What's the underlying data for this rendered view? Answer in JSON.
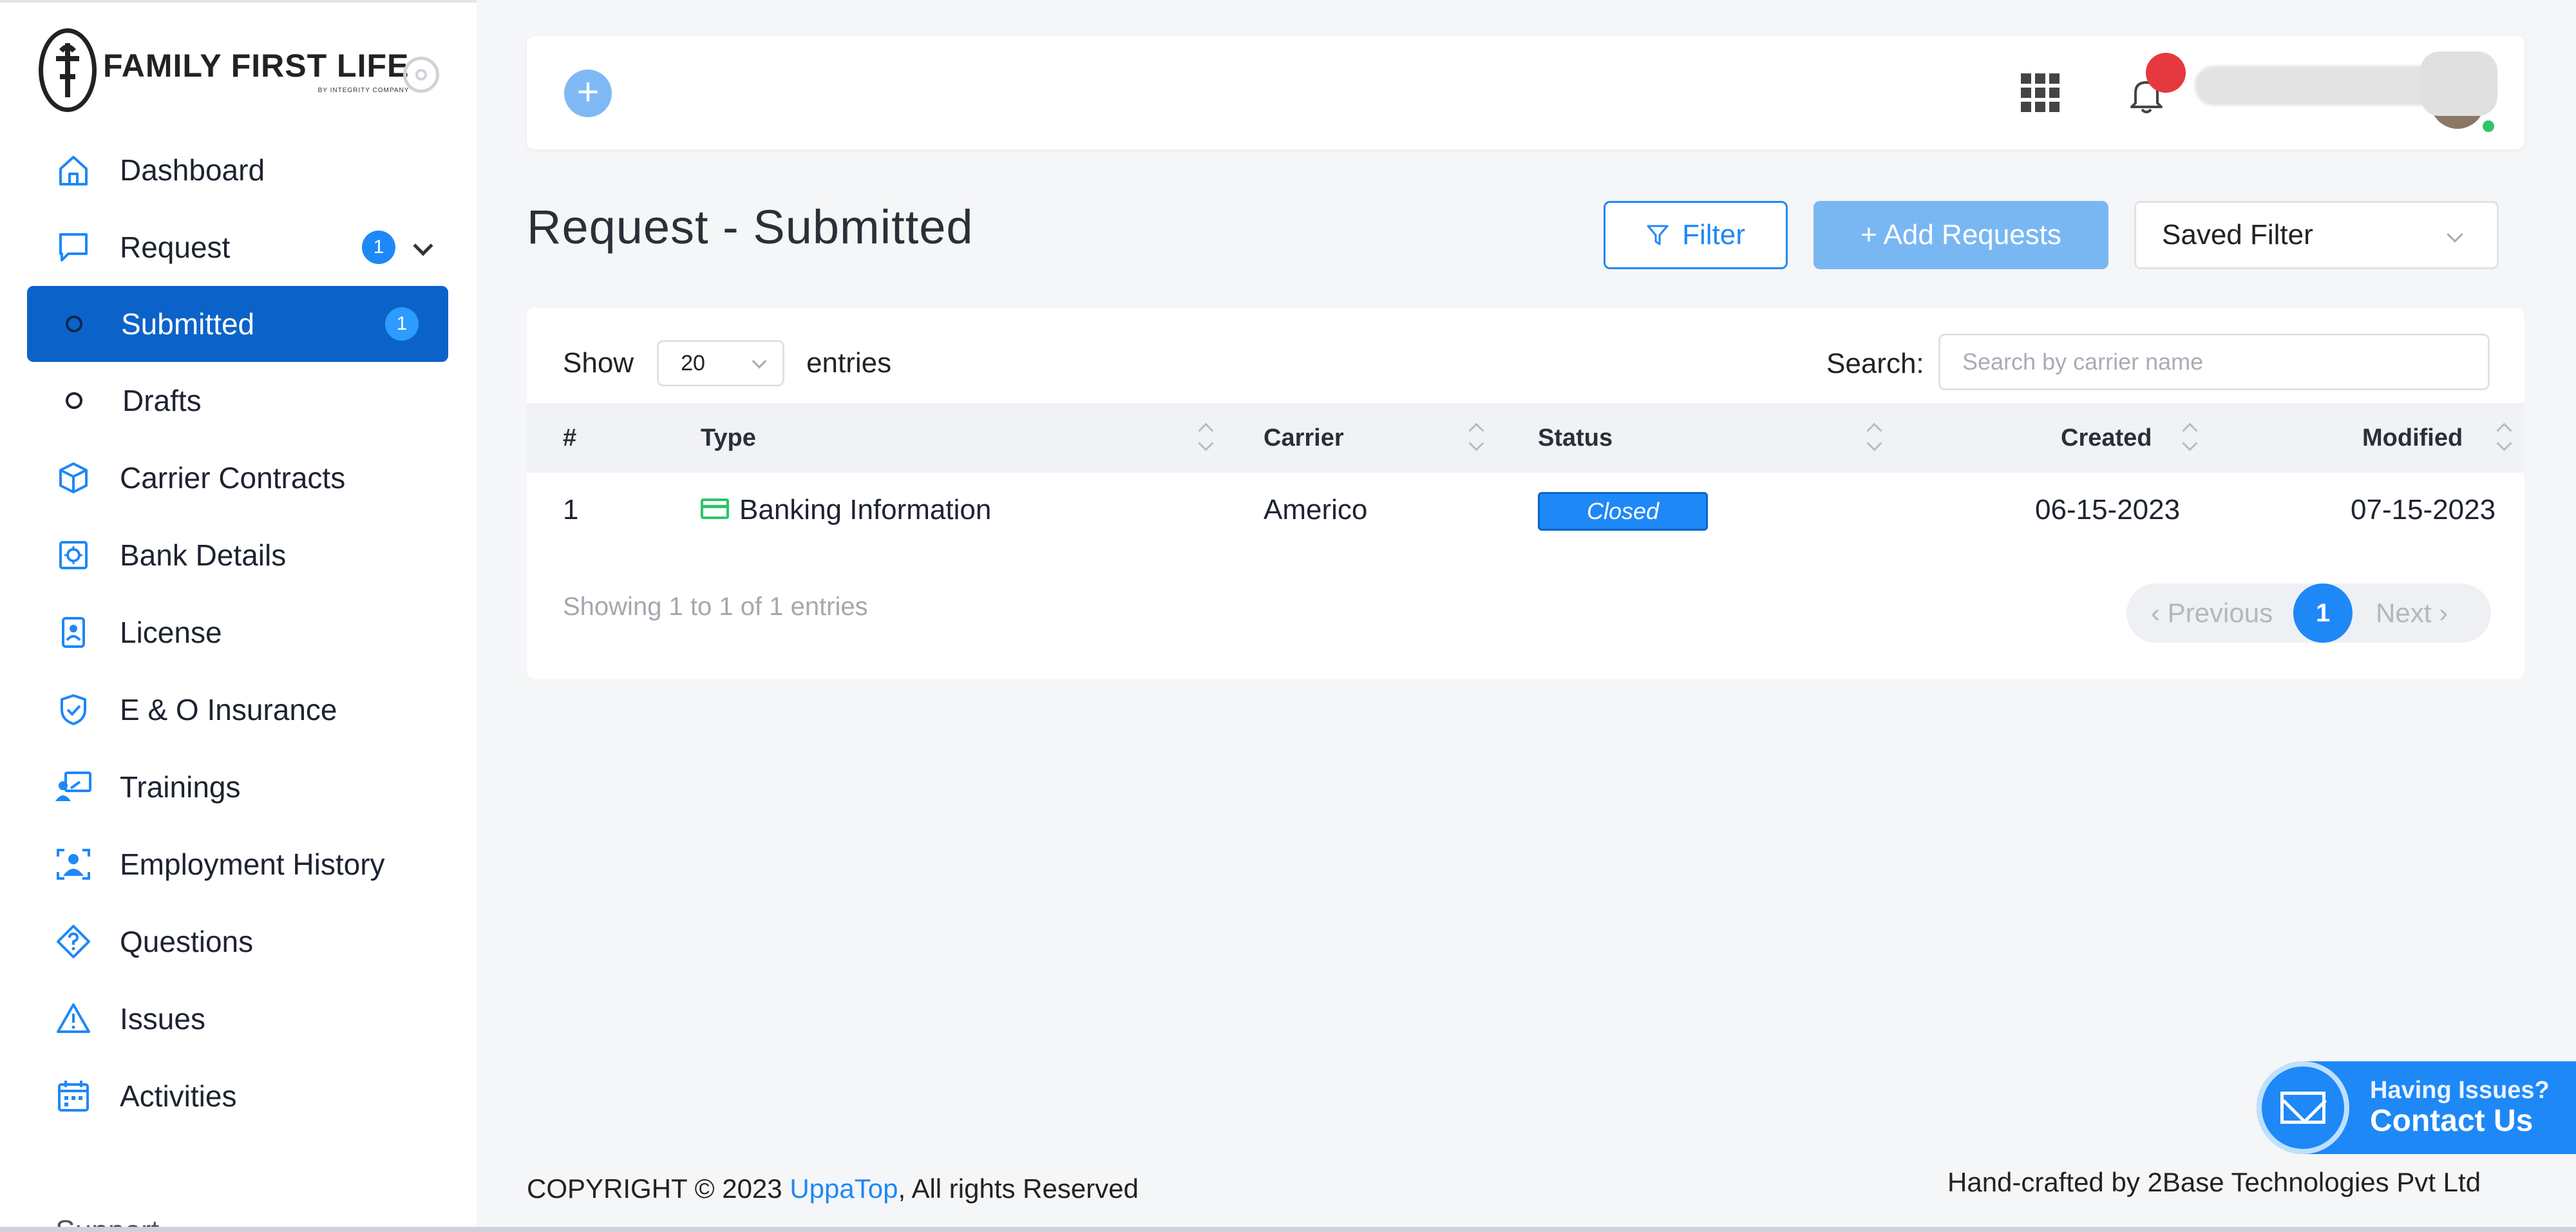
{
  "brand": {
    "title": "FAMILY FIRST LIFE",
    "subtitle": "BY INTEGRITY COMPANY"
  },
  "sidebar": {
    "items": [
      {
        "label": "Dashboard",
        "icon": "home-icon"
      },
      {
        "label": "Request",
        "icon": "chat-icon",
        "badge": "1"
      },
      {
        "label": "Submitted",
        "badge": "1",
        "active": true
      },
      {
        "label": "Drafts"
      },
      {
        "label": "Carrier Contracts",
        "icon": "box-icon"
      },
      {
        "label": "Bank Details",
        "icon": "vault-icon"
      },
      {
        "label": "License",
        "icon": "id-card-icon"
      },
      {
        "label": "E & O Insurance",
        "icon": "shield-check-icon"
      },
      {
        "label": "Trainings",
        "icon": "presentation-icon"
      },
      {
        "label": "Employment History",
        "icon": "user-frame-icon"
      },
      {
        "label": "Questions",
        "icon": "question-icon"
      },
      {
        "label": "Issues",
        "icon": "warning-icon"
      },
      {
        "label": "Activities",
        "icon": "calendar-icon"
      }
    ],
    "support": "Support"
  },
  "page": {
    "title": "Request - Submitted",
    "filter_label": "Filter",
    "add_label": "+ Add Requests",
    "saved_filter": "Saved Filter"
  },
  "table": {
    "show_label": "Show",
    "entries_value": "20",
    "entries_label": "entries",
    "search_label": "Search:",
    "search_placeholder": "Search by carrier name",
    "columns": [
      "#",
      "Type",
      "Carrier",
      "Status",
      "Created",
      "Modified"
    ],
    "rows": [
      {
        "num": "1",
        "type": "Banking Information",
        "carrier": "Americo",
        "status": "Closed",
        "created": "06-15-2023",
        "modified": "07-15-2023"
      }
    ],
    "showing": "Showing 1 to 1 of 1 entries",
    "pager": {
      "prev": "Previous",
      "page": "1",
      "next": "Next"
    }
  },
  "footer": {
    "copyright_prefix": "COPYRIGHT © 2023 ",
    "copyright_link": "UppaTop",
    "copyright_suffix": ", All rights Reserved",
    "handcrafted": "Hand-crafted by 2Base Technologies Pvt Ltd"
  },
  "contact": {
    "line1": "Having Issues?",
    "line2": "Contact Us"
  },
  "colors": {
    "accent": "#1e88f7",
    "active_nav": "#0b63c9",
    "notification": "#e5393f",
    "online": "#2ec46b"
  }
}
